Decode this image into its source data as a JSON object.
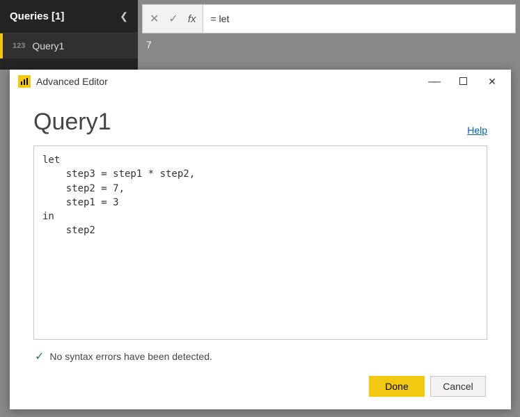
{
  "sidebar": {
    "title": "Queries [1]",
    "items": [
      {
        "icon": "123",
        "label": "Query1"
      }
    ]
  },
  "formulaBar": {
    "fx": "fx",
    "value": "= let"
  },
  "resultPreview": "7",
  "dialog": {
    "title": "Advanced Editor",
    "queryName": "Query1",
    "helpLabel": "Help",
    "code": "let\n    step3 = step1 * step2,\n    step2 = 7,\n    step1 = 3\nin\n    step2",
    "statusMessage": "No syntax errors have been detected.",
    "doneLabel": "Done",
    "cancelLabel": "Cancel"
  }
}
